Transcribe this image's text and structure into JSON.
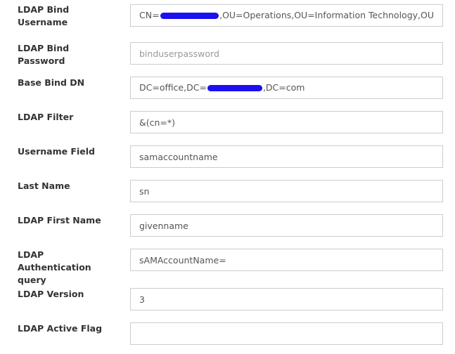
{
  "form": {
    "bind_username": {
      "label_line1": "LDAP Bind",
      "label_line2": "Username",
      "value_prefix": "CN=",
      "value_suffix": ",OU=Operations,OU=Information Technology,OU"
    },
    "bind_password": {
      "label": "LDAP Bind Password",
      "placeholder": "binduserpassword"
    },
    "base_bind_dn": {
      "label": "Base Bind DN",
      "value_prefix": "DC=office,DC=",
      "value_suffix": ",DC=com"
    },
    "ldap_filter": {
      "label": "LDAP Filter",
      "value": "&(cn=*)"
    },
    "username_field": {
      "label": "Username Field",
      "value": "samaccountname"
    },
    "last_name": {
      "label": "Last Name",
      "value": "sn"
    },
    "first_name": {
      "label": "LDAP First Name",
      "value": "givenname"
    },
    "auth_query": {
      "label_line1": "LDAP Authentication",
      "label_line2": "query",
      "value": "sAMAccountName="
    },
    "ldap_version": {
      "label": "LDAP Version",
      "value": "3"
    },
    "active_flag": {
      "label": "LDAP Active Flag",
      "value": ""
    }
  },
  "colors": {
    "redaction": "#1a10f0",
    "border": "#cccccc",
    "label_text": "#333333"
  }
}
